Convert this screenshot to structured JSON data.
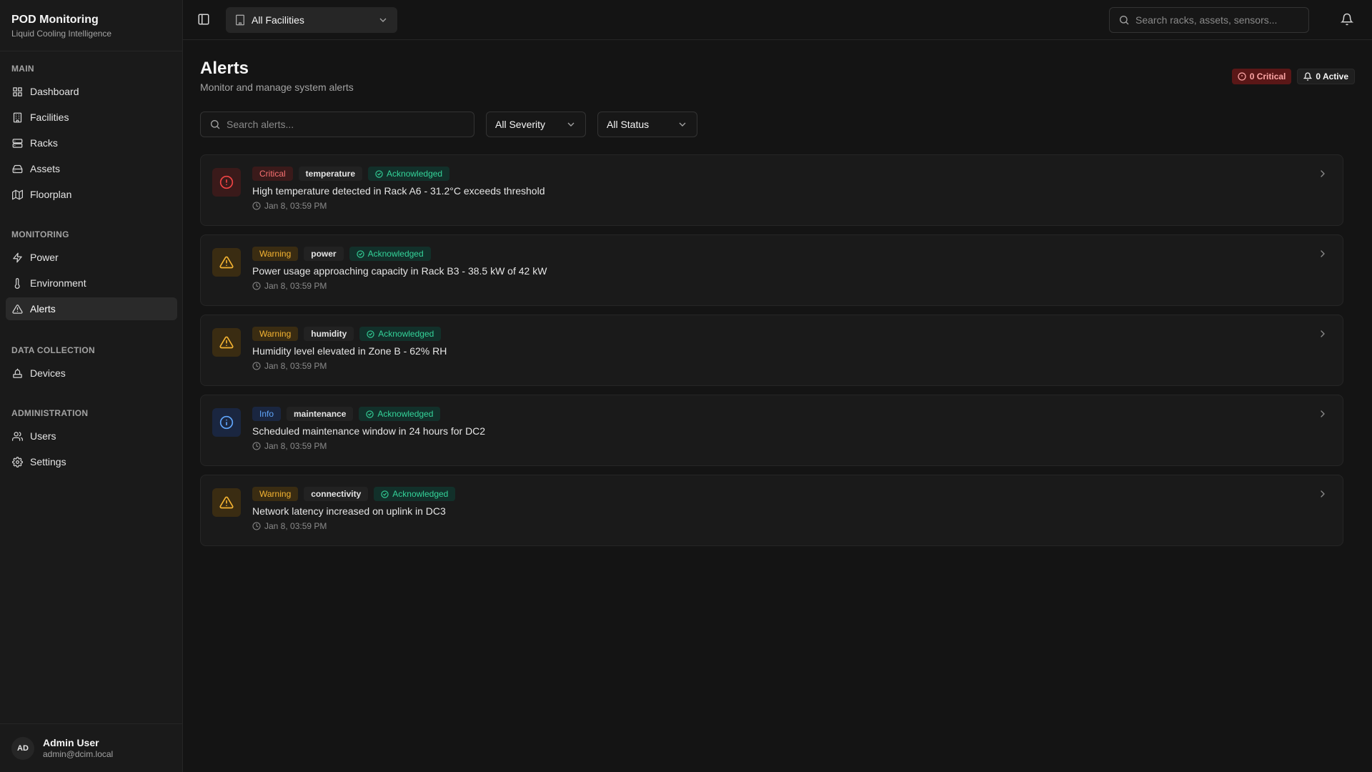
{
  "app": {
    "title": "POD Monitoring",
    "subtitle": "Liquid Cooling Intelligence"
  },
  "sidebar": {
    "sections": [
      {
        "heading": "MAIN",
        "items": [
          {
            "label": "Dashboard",
            "icon": "grid-icon"
          },
          {
            "label": "Facilities",
            "icon": "building-icon"
          },
          {
            "label": "Racks",
            "icon": "server-icon"
          },
          {
            "label": "Assets",
            "icon": "hard-drive-icon"
          },
          {
            "label": "Floorplan",
            "icon": "map-icon"
          }
        ]
      },
      {
        "heading": "MONITORING",
        "items": [
          {
            "label": "Power",
            "icon": "zap-icon"
          },
          {
            "label": "Environment",
            "icon": "thermometer-icon"
          },
          {
            "label": "Alerts",
            "icon": "alert-triangle-icon",
            "active": true
          }
        ]
      },
      {
        "heading": "DATA COLLECTION",
        "items": [
          {
            "label": "Devices",
            "icon": "device-icon"
          }
        ]
      },
      {
        "heading": "ADMINISTRATION",
        "items": [
          {
            "label": "Users",
            "icon": "users-icon"
          },
          {
            "label": "Settings",
            "icon": "gear-icon"
          }
        ]
      }
    ],
    "user": {
      "initials": "AD",
      "name": "Admin User",
      "email": "admin@dcim.local"
    }
  },
  "topbar": {
    "facility_select": "All Facilities",
    "search_placeholder": "Search racks, assets, sensors..."
  },
  "page": {
    "title": "Alerts",
    "subtitle": "Monitor and manage system alerts",
    "critical_badge": "0 Critical",
    "active_badge": "0 Active"
  },
  "filters": {
    "search_placeholder": "Search alerts...",
    "severity": "All Severity",
    "status": "All Status"
  },
  "alerts": [
    {
      "severity": "Critical",
      "category": "temperature",
      "status": "Acknowledged",
      "message": "High temperature detected in Rack A6 - 31.2°C exceeds threshold",
      "time": "Jan 8, 03:59 PM"
    },
    {
      "severity": "Warning",
      "category": "power",
      "status": "Acknowledged",
      "message": "Power usage approaching capacity in Rack B3 - 38.5 kW of 42 kW",
      "time": "Jan 8, 03:59 PM"
    },
    {
      "severity": "Warning",
      "category": "humidity",
      "status": "Acknowledged",
      "message": "Humidity level elevated in Zone B - 62% RH",
      "time": "Jan 8, 03:59 PM"
    },
    {
      "severity": "Info",
      "category": "maintenance",
      "status": "Acknowledged",
      "message": "Scheduled maintenance window in 24 hours for DC2",
      "time": "Jan 8, 03:59 PM"
    },
    {
      "severity": "Warning",
      "category": "connectivity",
      "status": "Acknowledged",
      "message": "Network latency increased on uplink in DC3",
      "time": "Jan 8, 03:59 PM"
    }
  ],
  "colors": {
    "background": "#141414",
    "sidebar": "#1a1a1a",
    "critical": "#ef4444",
    "warning": "#f5b432",
    "info": "#60a5fa",
    "acknowledged": "#34d399"
  }
}
